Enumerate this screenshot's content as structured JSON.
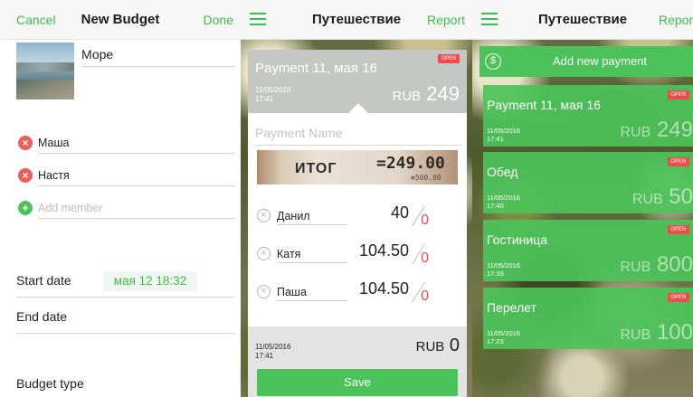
{
  "new_budget": {
    "cancel_label": "Cancel",
    "title": "New Budget",
    "done_label": "Done",
    "budget_name": "Море",
    "members": [
      "Маша",
      "Настя"
    ],
    "add_member_placeholder": "Add member",
    "start_date_label": "Start date",
    "start_date_value": "мая 12  18:32",
    "end_date_label": "End date",
    "budget_type_label": "Budget type"
  },
  "payment_detail": {
    "title": "Путешествие",
    "report_label": "Report",
    "header_title": "Payment 11, мая 16",
    "open_label": "OPEN",
    "header_date": "11/05/2016",
    "header_time": "17:41",
    "header_currency": "RUB",
    "header_amount": "249",
    "payment_name_placeholder": "Payment Name",
    "receipt_line1": "ИТОГ",
    "receipt_line2": "=249.00",
    "receipt_line3": "≡500.00",
    "participants": [
      {
        "name": "Данил",
        "amount": "40",
        "paid": "0"
      },
      {
        "name": "Катя",
        "amount": "104.50",
        "paid": "0"
      },
      {
        "name": "Паша",
        "amount": "104.50",
        "paid": "0"
      }
    ],
    "footer_date": "11/05/2016",
    "footer_time": "17:41",
    "footer_currency": "RUB",
    "footer_amount": "0",
    "save_label": "Save"
  },
  "payment_list": {
    "title": "Путешествие",
    "report_label": "Report",
    "add_payment_label": "Add new payment",
    "add_payment_icon": "$",
    "payments": [
      {
        "title": "Payment 11, мая 16",
        "date": "11/05/2016",
        "time": "17:41",
        "currency": "RUB",
        "amount": "249",
        "status": "OPEN"
      },
      {
        "title": "Обед",
        "date": "11/05/2016",
        "time": "17:40",
        "currency": "RUB",
        "amount": "50",
        "status": "OPEN"
      },
      {
        "title": "Гостиница",
        "date": "11/05/2016",
        "time": "17:39",
        "currency": "RUB",
        "amount": "800",
        "status": "OPEN"
      },
      {
        "title": "Перелет",
        "date": "11/05/2016",
        "time": "17:23",
        "currency": "RUB",
        "amount": "100",
        "status": "OPEN"
      }
    ]
  }
}
